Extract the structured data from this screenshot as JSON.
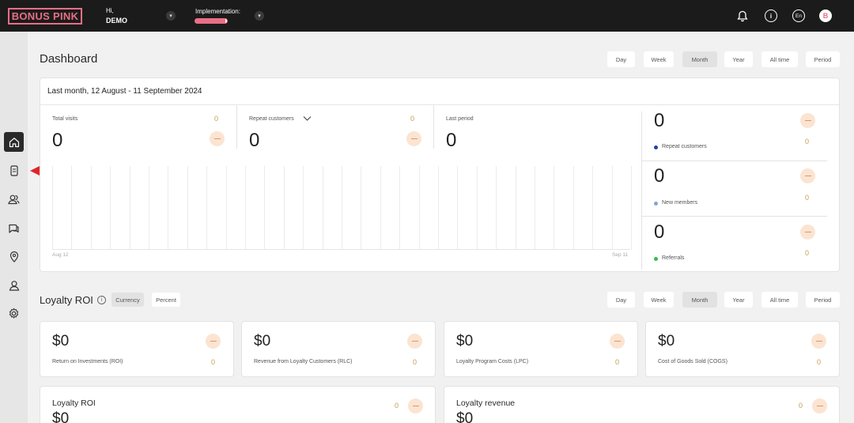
{
  "header": {
    "logo": "BONUS PINK",
    "greeting": "Hi,",
    "user_name": "DEMO",
    "implementation_label": "Implementation:",
    "implementation_progress": 0.95,
    "lang": "En",
    "avatar_initial": "B"
  },
  "page": {
    "title": "Dashboard"
  },
  "periods": [
    "Day",
    "Week",
    "Month",
    "Year",
    "All time",
    "Period"
  ],
  "active_period": "Month",
  "overview": {
    "range_title": "Last month, 12 August - 11 September 2024",
    "total_visits_label": "Total visits",
    "total_visits_value": "0",
    "total_visits_delta": "0",
    "repeat_label": "Repeat customers",
    "repeat_value": "0",
    "repeat_delta": "0",
    "last_period_label": "Last period",
    "last_period_value": "0",
    "axis_start": "Aug 12",
    "axis_end": "Sep 11",
    "side_stats": [
      {
        "value": "0",
        "label": "Repeat customers",
        "delta": "0",
        "color": "#1d3fb8"
      },
      {
        "value": "0",
        "label": "New members",
        "delta": "0",
        "color": "#8aa0d8"
      },
      {
        "value": "0",
        "label": "Referrals",
        "delta": "0",
        "color": "#2fbf4a"
      }
    ]
  },
  "roi": {
    "title": "Loyalty ROI",
    "modes": [
      "Currency",
      "Percent"
    ],
    "active_mode": "Currency",
    "cards": [
      {
        "value": "$0",
        "label": "Return on Investments (ROI)",
        "delta": "0"
      },
      {
        "value": "$0",
        "label": "Revenue from Loyalty Customers (RLC)",
        "delta": "0"
      },
      {
        "value": "$0",
        "label": "Loyalty Program Costs (LPC)",
        "delta": "0"
      },
      {
        "value": "$0",
        "label": "Cost of Goods Sold (COGS)",
        "delta": "0"
      }
    ],
    "bottom_cards": [
      {
        "title": "Loyalty ROI",
        "value": "$0",
        "delta": "0"
      },
      {
        "title": "Loyalty revenue",
        "value": "$0",
        "delta": "0"
      }
    ]
  },
  "icons": [
    "home-icon",
    "receipt-icon",
    "users-icon",
    "chat-icon",
    "location-icon",
    "user-icon",
    "gear-icon",
    "bell-icon",
    "info-icon",
    "arrow-icon"
  ]
}
